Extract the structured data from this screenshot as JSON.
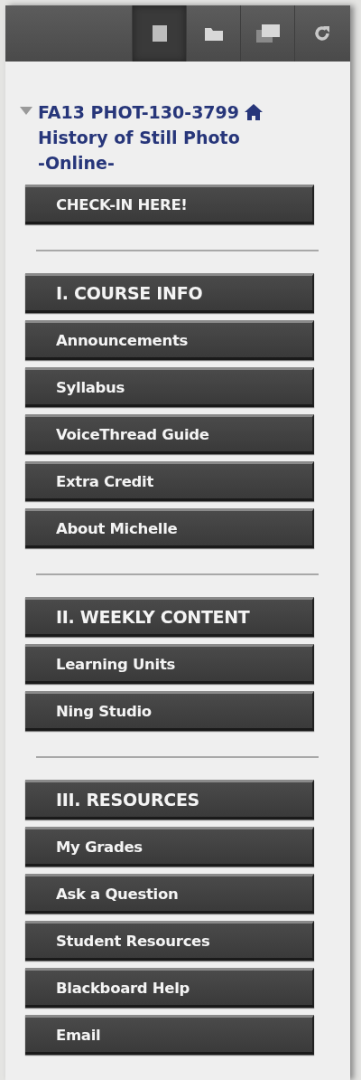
{
  "toolbar": {
    "tools": [
      {
        "kind": "list",
        "selected": true
      },
      {
        "kind": "folder",
        "selected": false
      },
      {
        "kind": "windows",
        "selected": false
      },
      {
        "kind": "refresh",
        "selected": false
      }
    ]
  },
  "course": {
    "expanded": true,
    "title_lines": [
      "FA13 PHOT-130-3799",
      "History of Still Photo",
      "-Online-"
    ]
  },
  "sections": [
    {
      "items": [
        {
          "kind": "link",
          "label": "CHECK-IN HERE!"
        }
      ]
    },
    {
      "items": [
        {
          "kind": "heading",
          "label": "I. COURSE INFO"
        },
        {
          "kind": "link",
          "label": "Announcements"
        },
        {
          "kind": "link",
          "label": "Syllabus"
        },
        {
          "kind": "link",
          "label": "VoiceThread Guide"
        },
        {
          "kind": "link",
          "label": "Extra Credit"
        },
        {
          "kind": "link",
          "label": "About Michelle"
        }
      ]
    },
    {
      "items": [
        {
          "kind": "heading",
          "label": "II. WEEKLY CONTENT"
        },
        {
          "kind": "link",
          "label": "Learning Units"
        },
        {
          "kind": "link",
          "label": "Ning Studio"
        }
      ]
    },
    {
      "items": [
        {
          "kind": "heading",
          "label": "III. RESOURCES"
        },
        {
          "kind": "link",
          "label": "My Grades"
        },
        {
          "kind": "link",
          "label": "Ask a Question"
        },
        {
          "kind": "link",
          "label": "Student Resources"
        },
        {
          "kind": "link",
          "label": "Blackboard Help"
        },
        {
          "kind": "link",
          "label": "Email"
        }
      ]
    }
  ]
}
